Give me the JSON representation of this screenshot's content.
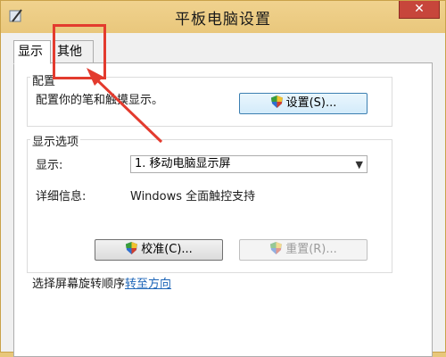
{
  "window": {
    "title": "平板电脑设置",
    "close_label": "✕"
  },
  "tabs": [
    {
      "label": "显示"
    },
    {
      "label": "其他"
    }
  ],
  "config_group": {
    "label": "配置",
    "description": "配置你的笔和触摸显示。",
    "setup_button": "设置(S)..."
  },
  "display_group": {
    "label": "显示选项",
    "display_label": "显示:",
    "display_value": "1. 移动电脑显示屏",
    "details_label": "详细信息:",
    "details_value": "Windows 全面触控支持",
    "calibrate_button": "校准(C)...",
    "reset_button": "重置(R)..."
  },
  "rotation": {
    "text": "选择屏幕旋转顺序",
    "link": "转至方向"
  },
  "colors": {
    "annotation": "#e33b2e",
    "link": "#1e66b8"
  }
}
